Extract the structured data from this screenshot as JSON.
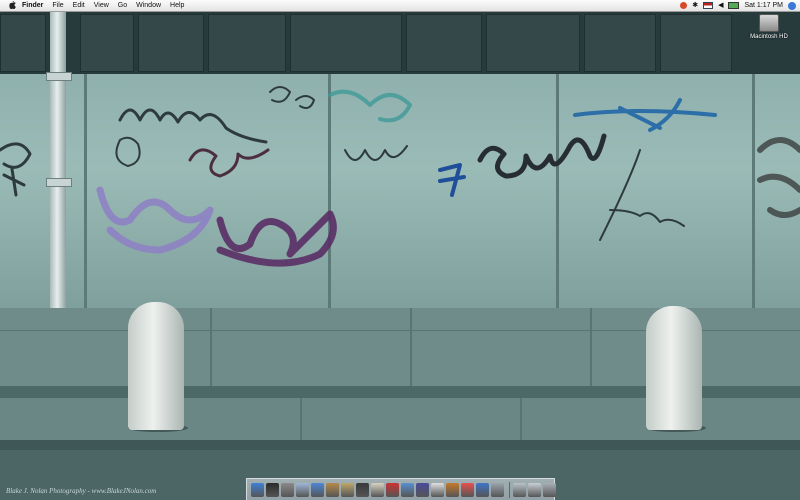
{
  "menubar": {
    "apple_icon": "apple-icon",
    "menus": [
      "Finder",
      "File",
      "Edit",
      "View",
      "Go",
      "Window",
      "Help"
    ],
    "extras": {
      "icons": [
        "spotlight-menu-icon",
        "bluetooth-icon",
        "flag-icon",
        "volume-icon",
        "battery-icon"
      ],
      "clock": "Sat 1:17 PM",
      "spotlight_icon": "spotlight-icon"
    }
  },
  "desktop": {
    "drive_label": "Macintosh HD"
  },
  "wallpaper": {
    "credit": "Blake J. Nolan Photography - www.BlakeJNolan.com"
  },
  "dock": {
    "items": [
      {
        "icon": "finder-icon",
        "color": "#3f7fd6"
      },
      {
        "icon": "dashboard-icon",
        "color": "#2b2b2b"
      },
      {
        "icon": "system-preferences-icon",
        "color": "#8a8a8a"
      },
      {
        "icon": "mail-icon",
        "color": "#9fb7d8"
      },
      {
        "icon": "safari-icon",
        "color": "#4e86d8"
      },
      {
        "icon": "address-book-icon",
        "color": "#b58a4a"
      },
      {
        "icon": "ichat-icon",
        "color": "#bfa76a"
      },
      {
        "icon": "itunes-icon",
        "color": "#3a3a3a"
      },
      {
        "icon": "iphoto-icon",
        "color": "#d8d2c0"
      },
      {
        "icon": "imovie-icon",
        "color": "#cc3333"
      },
      {
        "icon": "garageband-icon",
        "color": "#5a8fd0"
      },
      {
        "icon": "idvd-icon",
        "color": "#4a4a9a"
      },
      {
        "icon": "iweb-icon",
        "color": "#e0e0e0"
      },
      {
        "icon": "guitar-icon",
        "color": "#c47a2c"
      },
      {
        "icon": "ical-icon",
        "color": "#e65050"
      },
      {
        "icon": "quicktime-icon",
        "color": "#3e74c8"
      },
      {
        "icon": "preview-icon",
        "color": "#9aa4ae"
      }
    ],
    "right_items": [
      {
        "icon": "applications-stack-icon",
        "color": "#b9c3cc"
      },
      {
        "icon": "documents-stack-icon",
        "color": "#c9d0d6"
      },
      {
        "icon": "trash-icon",
        "color": "#a8b0b8"
      }
    ]
  }
}
